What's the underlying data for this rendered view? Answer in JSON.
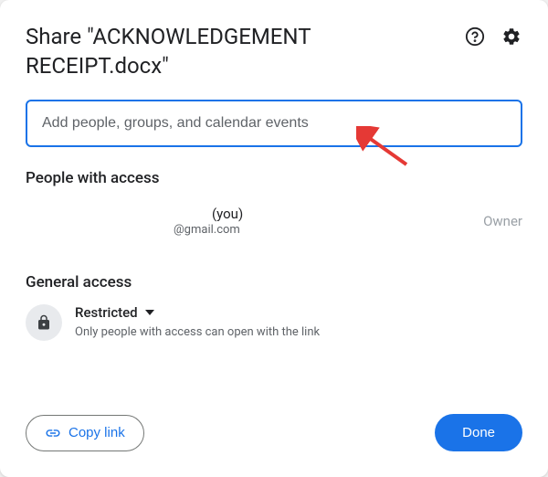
{
  "title": "Share \"ACKNOWLEDGEMENT RECEIPT.docx\"",
  "input": {
    "placeholder": "Add people, groups, and calendar events"
  },
  "sections": {
    "people_title": "People with access",
    "general_title": "General access"
  },
  "person": {
    "name_suffix": "(you)",
    "email_suffix": "@gmail.com",
    "role": "Owner"
  },
  "access": {
    "label": "Restricted",
    "description": "Only people with access can open with the link"
  },
  "buttons": {
    "copy_link": "Copy link",
    "done": "Done"
  }
}
